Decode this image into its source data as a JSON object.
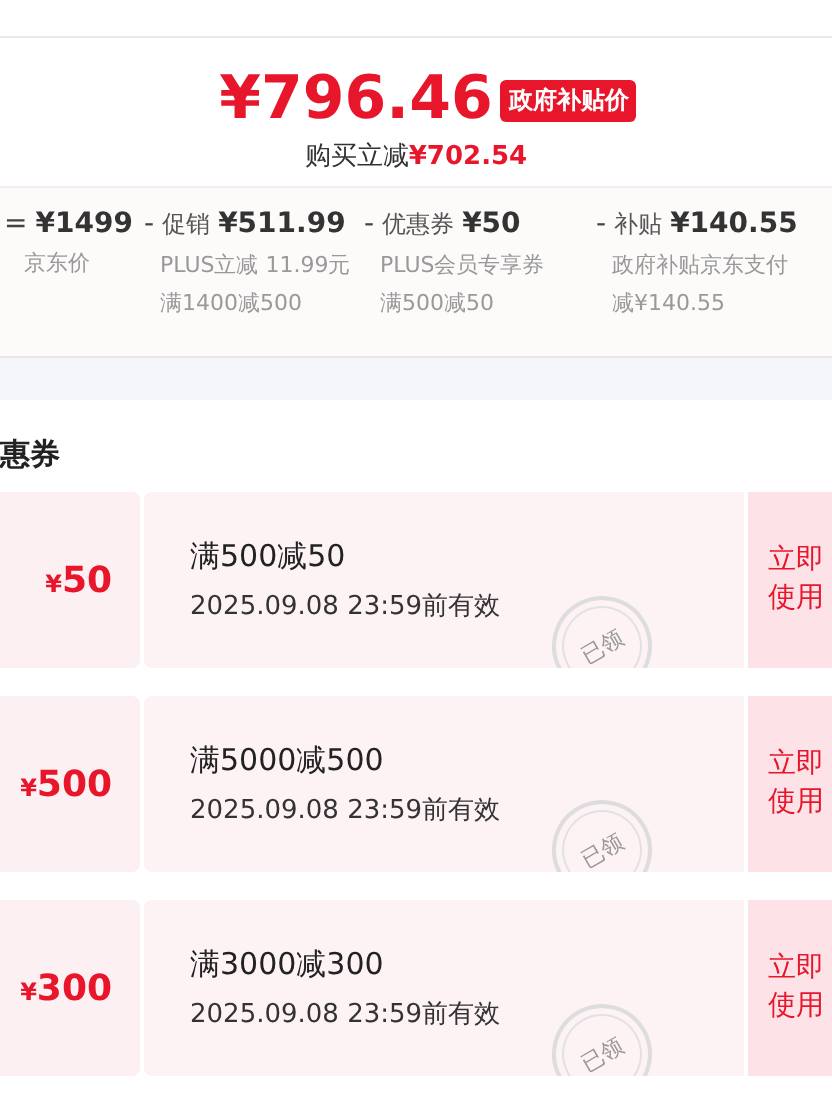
{
  "price": {
    "amount": "¥796.46",
    "badge": "政府补贴价",
    "saving_label": "购买立减",
    "saving_amount": "¥702.54"
  },
  "breakdown": [
    {
      "op": "=",
      "amount": "¥1499",
      "notes": [
        "京东价"
      ]
    },
    {
      "op": "-",
      "label": "促销",
      "amount": "¥511.99",
      "notes": [
        "PLUS立减 11.99元",
        "满1400减500"
      ]
    },
    {
      "op": "-",
      "label": "优惠券",
      "amount": "¥50",
      "notes": [
        "PLUS会员专享券",
        "满500减50"
      ]
    },
    {
      "op": "-",
      "label": "补贴",
      "amount": "¥140.55",
      "notes": [
        "政府补贴京东支付",
        "减¥140.55"
      ]
    }
  ],
  "coupon_section": {
    "title": "惠券"
  },
  "coupons": [
    {
      "currency": "¥",
      "value": "50",
      "rule": "满500减50",
      "validity": "2025.09.08 23:59前有效",
      "claimed": true,
      "stamp": "已领",
      "action": "立即使用"
    },
    {
      "currency": "¥",
      "value": "500",
      "rule": "满5000减500",
      "validity": "2025.09.08 23:59前有效",
      "claimed": true,
      "stamp": "已领",
      "action": "立即使用"
    },
    {
      "currency": "¥",
      "value": "300",
      "rule": "满3000减300",
      "validity": "2025.09.08 23:59前有效",
      "claimed": true,
      "stamp": "已领",
      "action": "立即使用"
    }
  ]
}
